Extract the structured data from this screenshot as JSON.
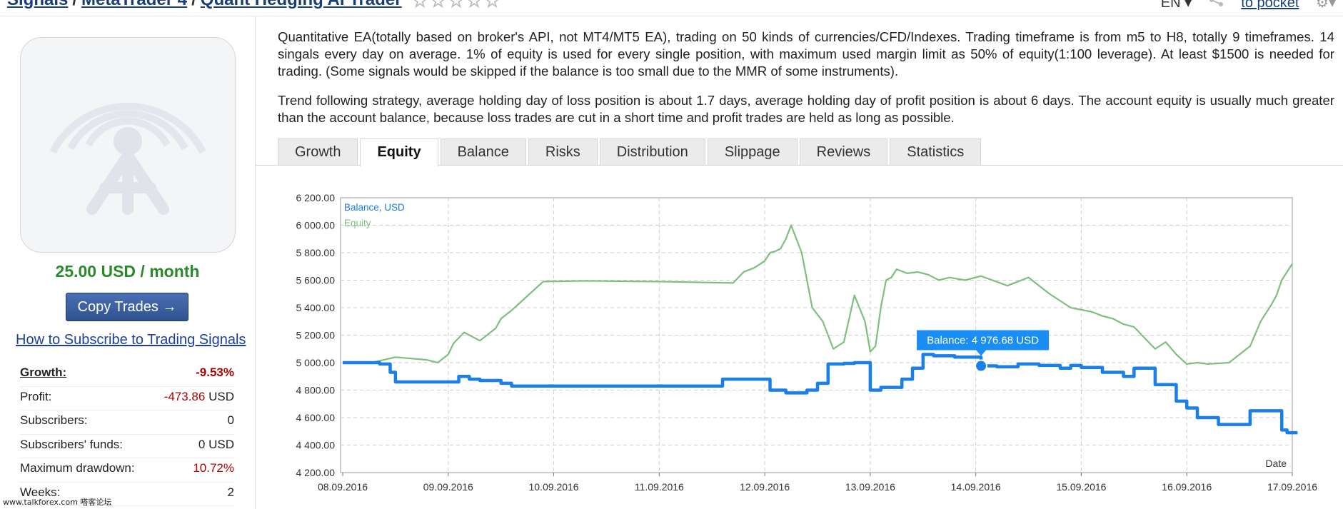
{
  "breadcrumb": {
    "item1": "Signals",
    "sep": "/",
    "item2": "MetaTrader 4",
    "item3": "Quant Hedging AI Trader",
    "stars": "☆☆☆☆☆"
  },
  "topbar": {
    "language": "EN ▾",
    "share_icon": "share-icon",
    "pocket": "to pocket",
    "gear_icon": "gear-icon"
  },
  "sidebar": {
    "avatar_icon": "signal-tower-icon",
    "price": "25.00 USD / month",
    "copy_button": "Copy Trades →",
    "howto_link": "How to Subscribe to Trading Signals",
    "stats": [
      {
        "label": "Growth:",
        "value": "-9.53%"
      },
      {
        "label": "Profit:",
        "value": "-473.86",
        "unit": "USD"
      },
      {
        "label": "Subscribers:",
        "value": "0"
      },
      {
        "label": "Subscribers' funds:",
        "value": "0 USD"
      },
      {
        "label": "Maximum drawdown:",
        "value": "10.72%"
      },
      {
        "label": "Weeks:",
        "value": "2"
      }
    ]
  },
  "description": {
    "p1": "Quantitative EA(totally based on broker's API, not MT4/MT5 EA), trading on 50 kinds of currencies/CFD/Indexes. Trading timeframe is from m5 to H8, totally 9 timeframes. 14 singals every day on average. 1% of equity is used for every single position, with maximum used margin limit as 50% of equity(1:100 leverage). At least $1500 is needed for trading. (Some signals would be skipped if the balance is too small due to the MMR of some instruments).",
    "p2": "Trend following strategy, average holding day of loss position is about 1.7 days, average holding day of profit position is about 6 days. The account equity is usually much greater than the account balance, because loss trades are cut in a short time and profit trades are held as long as possible."
  },
  "tabs": [
    "Growth",
    "Equity",
    "Balance",
    "Risks",
    "Distribution",
    "Slippage",
    "Reviews",
    "Statistics"
  ],
  "active_tab": "Equity",
  "watermark": "www.talkforex.com 嗒客论坛",
  "colors": {
    "balance": "#1a7fe8",
    "equity": "#7dbf7d",
    "price": "#2a8a2a",
    "negative": "#b00000"
  },
  "chart_data": {
    "type": "line",
    "xlabel": "Date",
    "ylim": [
      4200,
      6200
    ],
    "y_ticks": [
      "4 200.00",
      "4 400.00",
      "4 600.00",
      "4 800.00",
      "5 000.00",
      "5 200.00",
      "5 400.00",
      "5 600.00",
      "5 800.00",
      "6 000.00",
      "6 200.00"
    ],
    "x_ticks": [
      "08.09.2016",
      "09.09.2016",
      "10.09.2016",
      "11.09.2016",
      "12.09.2016",
      "13.09.2016",
      "14.09.2016",
      "15.09.2016",
      "16.09.2016",
      "17.09.2016"
    ],
    "legend": [
      "Balance, USD",
      "Equity"
    ],
    "tooltip": "Balance: 4 976.68 USD",
    "tooltip_point": {
      "x": 6.05,
      "y": 4976.68
    },
    "grid": true,
    "series": [
      {
        "name": "Balance, USD",
        "step": true,
        "x": [
          0,
          0.35,
          0.45,
          0.5,
          1.1,
          1.2,
          1.3,
          1.5,
          1.55,
          1.6,
          3.45,
          3.6,
          3.7,
          4.05,
          4.2,
          4.4,
          4.5,
          4.6,
          4.75,
          4.85,
          5.0,
          5.1,
          5.3,
          5.4,
          5.5,
          5.6,
          5.8,
          6.05,
          6.2,
          6.4,
          6.6,
          6.8,
          6.9,
          7.0,
          7.2,
          7.4,
          7.5,
          7.7,
          7.9,
          8.0,
          8.1,
          8.3,
          8.6,
          8.9,
          8.95,
          9.05
        ],
        "y": [
          5000,
          4990,
          4930,
          4860,
          4900,
          4880,
          4870,
          4850,
          4850,
          4830,
          4830,
          4880,
          4880,
          4800,
          4780,
          4800,
          4850,
          4990,
          4995,
          5000,
          4800,
          4820,
          4880,
          4960,
          5060,
          5050,
          5040,
          4976.68,
          4970,
          4990,
          4980,
          4960,
          4980,
          4965,
          4930,
          4900,
          4960,
          4840,
          4720,
          4670,
          4600,
          4550,
          4650,
          4510,
          4490,
          4490
        ]
      },
      {
        "name": "Equity",
        "x": [
          0,
          0.15,
          0.3,
          0.5,
          0.8,
          0.9,
          1.0,
          1.05,
          1.15,
          1.3,
          1.45,
          1.5,
          1.6,
          1.7,
          1.9,
          2.3,
          3.0,
          3.7,
          3.8,
          3.9,
          4.0,
          4.05,
          4.1,
          4.15,
          4.2,
          4.25,
          4.35,
          4.45,
          4.55,
          4.65,
          4.75,
          4.85,
          4.95,
          5.0,
          5.05,
          5.1,
          5.15,
          5.2,
          5.25,
          5.35,
          5.45,
          5.55,
          5.65,
          5.75,
          5.9,
          6.05,
          6.3,
          6.5,
          6.6,
          6.7,
          6.8,
          6.9,
          7.1,
          7.2,
          7.3,
          7.4,
          7.5,
          7.6,
          7.7,
          7.8,
          7.9,
          8.0,
          8.1,
          8.2,
          8.4,
          8.6,
          8.7,
          8.75,
          8.8,
          8.85,
          8.9,
          8.95,
          9.0
        ],
        "y": [
          5000,
          4995,
          5005,
          5040,
          5020,
          5000,
          5060,
          5140,
          5220,
          5160,
          5250,
          5320,
          5380,
          5450,
          5590,
          5595,
          5590,
          5580,
          5660,
          5690,
          5740,
          5800,
          5810,
          5830,
          5900,
          6000,
          5800,
          5400,
          5300,
          5100,
          5150,
          5490,
          5300,
          5080,
          5120,
          5400,
          5600,
          5620,
          5680,
          5650,
          5660,
          5640,
          5600,
          5620,
          5600,
          5630,
          5560,
          5620,
          5560,
          5500,
          5450,
          5400,
          5370,
          5340,
          5320,
          5280,
          5260,
          5180,
          5100,
          5150,
          5060,
          4990,
          5000,
          4990,
          5000,
          5120,
          5300,
          5360,
          5420,
          5490,
          5600,
          5660,
          5720
        ]
      }
    ]
  }
}
